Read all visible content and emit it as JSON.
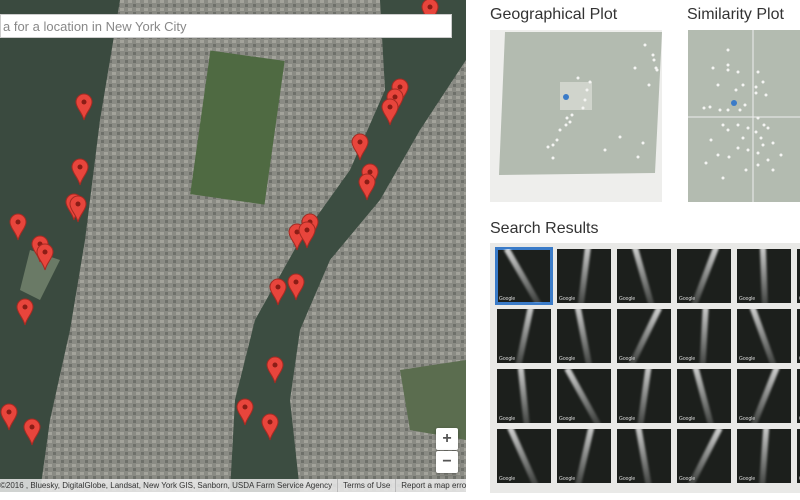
{
  "map": {
    "search_placeholder": "a for a location in New York City",
    "zoom_in": "+",
    "zoom_out": "−",
    "attribution": "©2016 , Bluesky, DigitalGlobe, Landsat, New York GIS, Sanborn, USDA Farm Service Agency",
    "terms": "Terms of Use",
    "report": "Report a map error",
    "marker_color": "#e8453c"
  },
  "geo_plot": {
    "title": "Geographical Plot",
    "highlight_color": "#3a7bc8",
    "bg_color": "#b9c0b6"
  },
  "similarity_plot": {
    "title": "Similarity Plot",
    "highlight_color": "#3a7bc8"
  },
  "results": {
    "title": "Search Results",
    "thumb_label": "Google",
    "selected_index": 0,
    "rows": 4,
    "columns_visible": 5
  }
}
